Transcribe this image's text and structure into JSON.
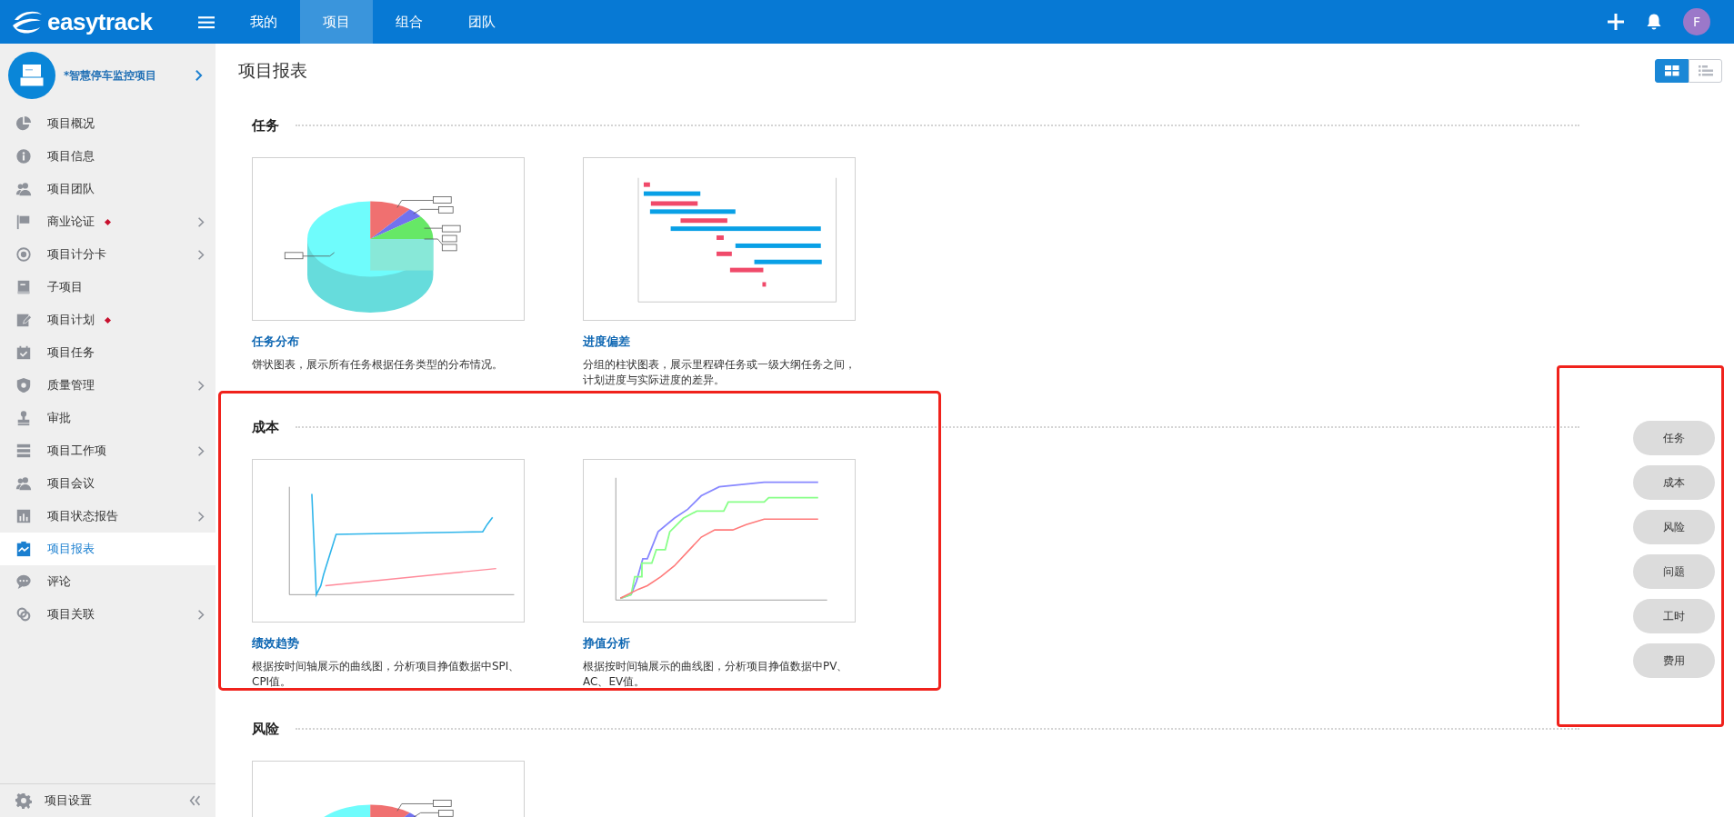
{
  "topbar": {
    "logo": "easytrack",
    "nav": [
      {
        "label": "我的",
        "selected": false
      },
      {
        "label": "项目",
        "selected": true
      },
      {
        "label": "组合",
        "selected": false
      },
      {
        "label": "团队",
        "selected": false
      }
    ],
    "avatar": "F"
  },
  "sidebar": {
    "project": "*智慧停车监控项目",
    "items": [
      {
        "label": "项目概况",
        "has_children": false,
        "flagged": false,
        "selected": false
      },
      {
        "label": "项目信息",
        "has_children": false,
        "flagged": false,
        "selected": false
      },
      {
        "label": "项目团队",
        "has_children": false,
        "flagged": false,
        "selected": false
      },
      {
        "label": "商业论证",
        "has_children": true,
        "flagged": true,
        "selected": false
      },
      {
        "label": "项目计分卡",
        "has_children": true,
        "flagged": false,
        "selected": false
      },
      {
        "label": "子项目",
        "has_children": false,
        "flagged": false,
        "selected": false
      },
      {
        "label": "项目计划",
        "has_children": false,
        "flagged": true,
        "selected": false
      },
      {
        "label": "项目任务",
        "has_children": false,
        "flagged": false,
        "selected": false
      },
      {
        "label": "质量管理",
        "has_children": true,
        "flagged": false,
        "selected": false
      },
      {
        "label": "审批",
        "has_children": false,
        "flagged": false,
        "selected": false
      },
      {
        "label": "项目工作项",
        "has_children": true,
        "flagged": false,
        "selected": false
      },
      {
        "label": "项目会议",
        "has_children": false,
        "flagged": false,
        "selected": false
      },
      {
        "label": "项目状态报告",
        "has_children": true,
        "flagged": false,
        "selected": false
      },
      {
        "label": "项目报表",
        "has_children": false,
        "flagged": false,
        "selected": true
      },
      {
        "label": "评论",
        "has_children": false,
        "flagged": false,
        "selected": false
      },
      {
        "label": "项目关联",
        "has_children": true,
        "flagged": false,
        "selected": false
      }
    ],
    "footer": "项目设置"
  },
  "page": {
    "title": "项目报表",
    "view_modes": [
      {
        "kind": "grid",
        "selected": true
      },
      {
        "kind": "list",
        "selected": false
      }
    ]
  },
  "sections": [
    {
      "title": "任务",
      "highlighted": false,
      "cards": [
        {
          "kind": "pie",
          "title": "任务分布",
          "description": "饼状图表，展示所有任务根据任务类型的分布情况。"
        },
        {
          "kind": "gantt",
          "title": "进度偏差",
          "description": "分组的柱状图表，展示里程碑任务或一级大纲任务之间，计划进度与实际进度的差异。"
        }
      ]
    },
    {
      "title": "成本",
      "highlighted": true,
      "cards": [
        {
          "kind": "trend",
          "title": "绩效趋势",
          "description": "根据按时间轴展示的曲线图，分析项目挣值数据中SPI、CPI值。"
        },
        {
          "kind": "curve",
          "title": "挣值分析",
          "description": "根据按时间轴展示的曲线图，分析项目挣值数据中PV、AC、EV值。"
        }
      ]
    },
    {
      "title": "风险",
      "highlighted": false,
      "cards": [
        {
          "kind": "pie"
        }
      ]
    }
  ],
  "quick_nav": {
    "highlighted": true,
    "items": [
      "任务",
      "成本",
      "风险",
      "问题",
      "工时",
      "费用"
    ]
  }
}
